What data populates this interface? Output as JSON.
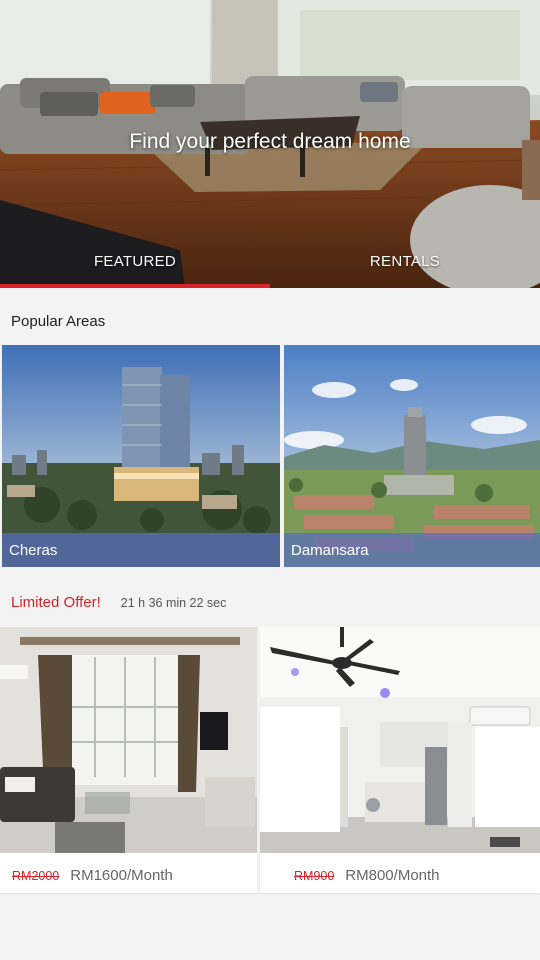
{
  "hero": {
    "title": "Find your perfect dream home",
    "tabs": [
      {
        "label": "FEATURED",
        "selected": true
      },
      {
        "label": "RENTALS",
        "selected": false
      }
    ]
  },
  "popular_areas": {
    "title": "Popular Areas",
    "items": [
      {
        "label": "Cheras"
      },
      {
        "label": "Damansara"
      }
    ]
  },
  "limited_offer": {
    "title": "Limited Offer!",
    "countdown": "21 h 36 min 22 sec",
    "listings": [
      {
        "old_price": "RM2000",
        "new_price": "RM1600/Month"
      },
      {
        "old_price": "RM900",
        "new_price": "RM800/Month"
      }
    ]
  },
  "colors": {
    "accent": "#d8232a",
    "area_label_bg": "#586ebe"
  }
}
